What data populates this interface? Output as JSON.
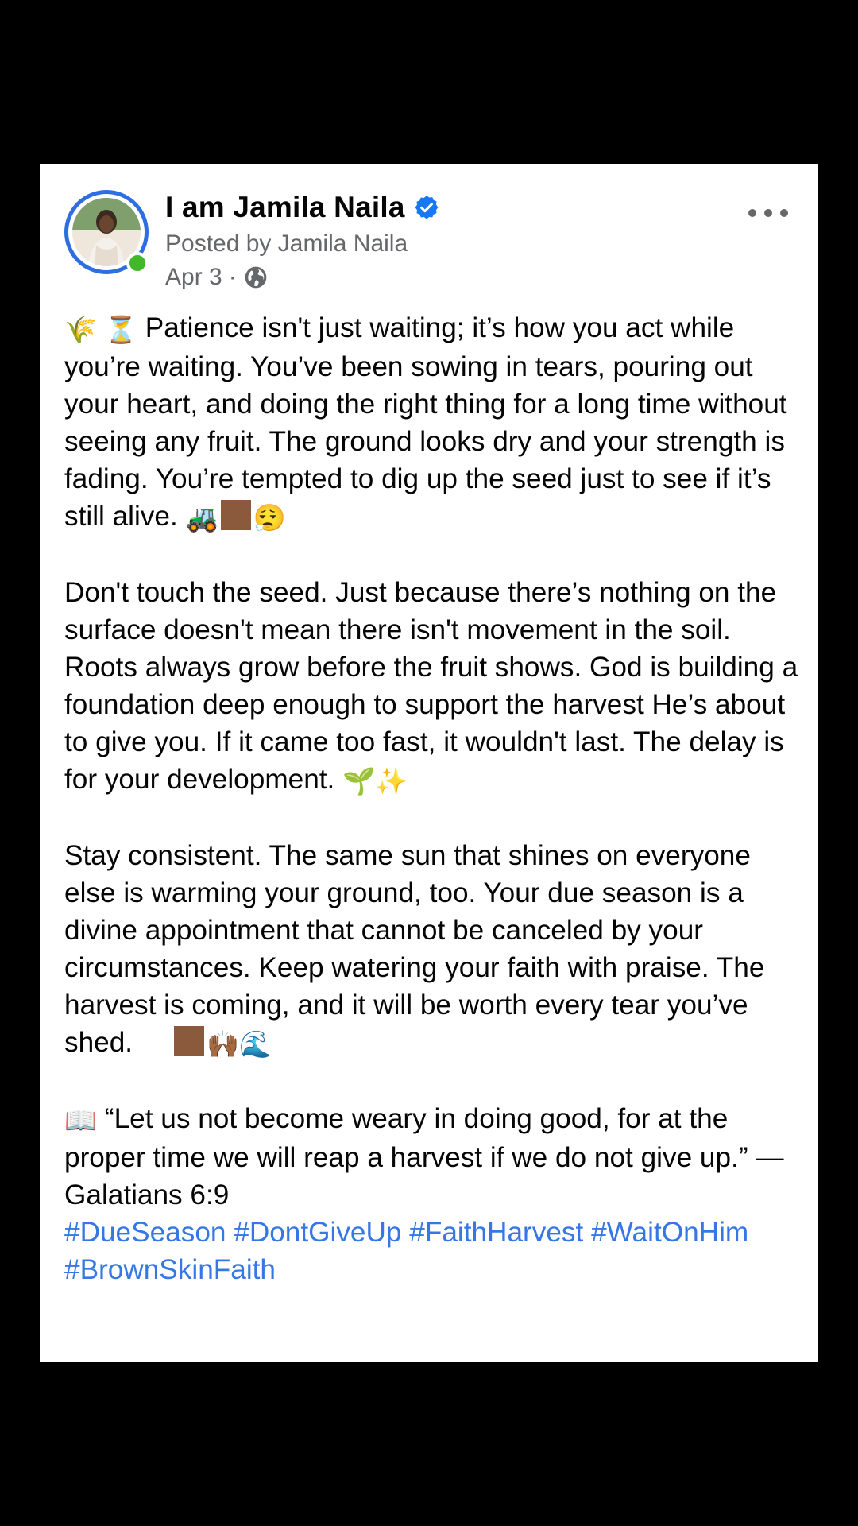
{
  "post": {
    "page_name": "I am Jamila Naila",
    "posted_by": "Posted by Jamila Naila",
    "date": "Apr 3",
    "separator": "·",
    "icons": {
      "verified": "verified-badge-icon",
      "privacy": "globe-icon",
      "more": "more-options-icon"
    },
    "colors": {
      "hashtag": "#3578e5",
      "secondary_text": "#65676b",
      "verified": "#1877f2",
      "online": "#42b72a"
    },
    "p1": {
      "emoji_a": "🌾",
      "emoji_b": "⏳",
      "text": "Patience isn't just waiting; it’s how you act while you’re waiting. You’ve been sowing in tears, pouring out your heart, and doing the right thing for a long time without seeing any fruit. The ground looks dry and your strength is fading. You’re tempted to dig up the seed just to see if it’s still alive.",
      "emoji_end": [
        "🚜",
        "😮‍💨"
      ]
    },
    "p2": {
      "text": "Don't touch the seed. Just because there’s nothing on the surface doesn't mean there isn't movement in the soil. Roots always grow before the fruit shows. God is building a foundation deep enough to support the harvest He’s about to give you. If it came too fast, it wouldn't last. The delay is for your development.",
      "emoji_end": [
        "🌱",
        "✨"
      ]
    },
    "p3": {
      "text": "Stay consistent. The same sun that shines on everyone else is warming your ground, too. Your due season is a divine appointment that cannot be canceled by your circumstances. Keep watering your faith with praise. The harvest is coming, and it will be worth every tear you’ve shed.",
      "emoji_end": [
        "🙌🏾",
        "🌊"
      ]
    },
    "p4": {
      "emoji": "📖",
      "text": "“Let us not become weary in doing good, for at the proper time we will reap a harvest if we do not give up.” — Galatians 6:9"
    },
    "hashtags": [
      "#DueSeason",
      "#DontGiveUp",
      "#FaithHarvest",
      "#WaitOnHim",
      "#BrownSkinFaith"
    ]
  }
}
